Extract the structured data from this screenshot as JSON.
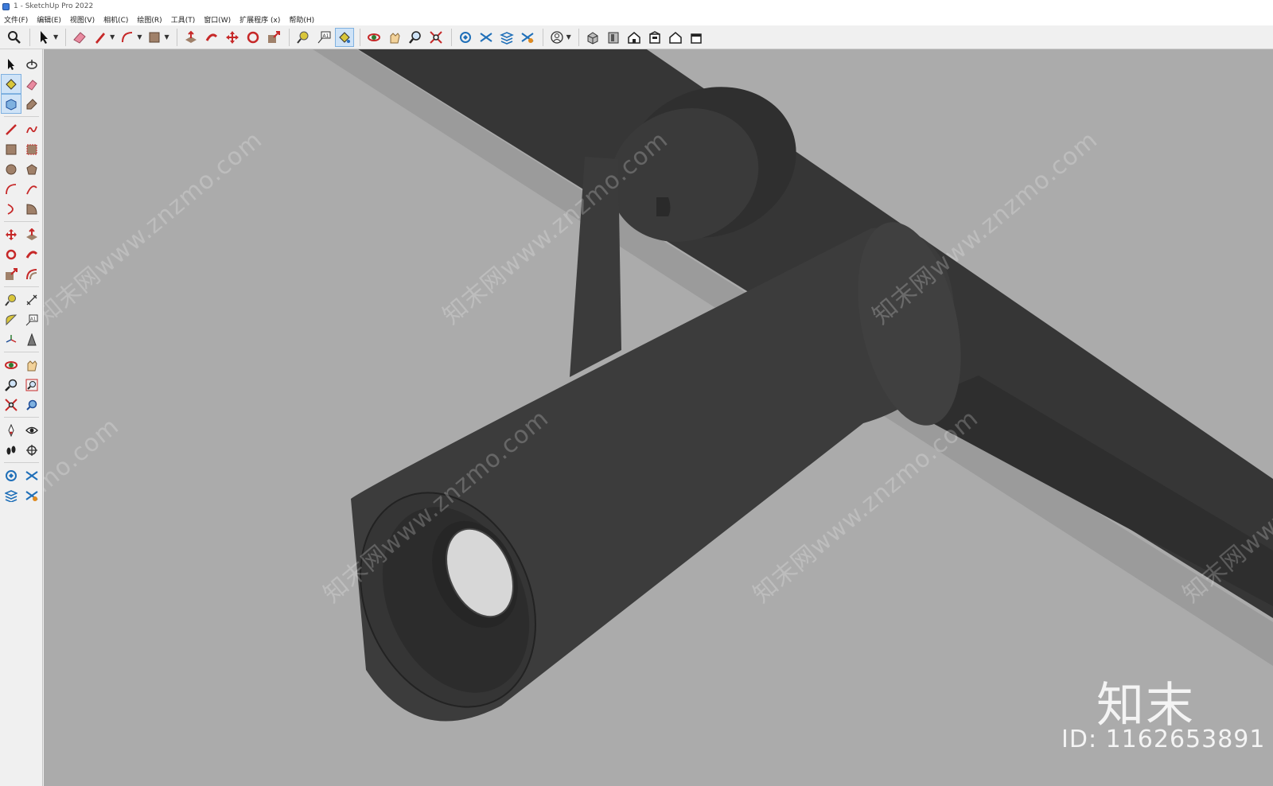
{
  "window": {
    "title": "1 - SketchUp Pro 2022",
    "accent": "#3d7bd9"
  },
  "menu": [
    "文件(F)",
    "编辑(E)",
    "视图(V)",
    "相机(C)",
    "绘图(R)",
    "工具(T)",
    "窗口(W)",
    "扩展程序 (x)",
    "帮助(H)"
  ],
  "toolbar": {
    "tools": [
      {
        "name": "zoom-icon"
      },
      {
        "name": "select-icon",
        "dropdown": true
      },
      {
        "name": "eraser-icon"
      },
      {
        "name": "pencil-icon",
        "dropdown": true
      },
      {
        "name": "arc-icon",
        "dropdown": true
      },
      {
        "name": "rectangle-icon",
        "dropdown": true
      },
      {
        "name": "push-pull-icon"
      },
      {
        "name": "follow-me-icon"
      },
      {
        "name": "move-icon"
      },
      {
        "name": "rotate-icon"
      },
      {
        "name": "scale-icon"
      },
      {
        "name": "tape-measure-icon"
      },
      {
        "name": "text-icon"
      },
      {
        "name": "paint-bucket-icon",
        "active": true
      },
      {
        "name": "orbit-icon"
      },
      {
        "name": "pan-icon"
      },
      {
        "name": "zoom-window-icon"
      },
      {
        "name": "zoom-extents-icon"
      },
      {
        "name": "warehouse-icon"
      },
      {
        "name": "extension-warehouse-icon"
      },
      {
        "name": "layout-icon"
      },
      {
        "name": "extension-manager-icon"
      },
      {
        "name": "account-icon",
        "dropdown": true
      },
      {
        "name": "iso-view-icon"
      },
      {
        "name": "top-view-icon"
      },
      {
        "name": "front-view-icon"
      },
      {
        "name": "right-view-icon"
      },
      {
        "name": "back-view-icon"
      },
      {
        "name": "left-view-icon"
      }
    ]
  },
  "watermark": {
    "text": "知末网www.znzmo.com"
  },
  "brand": {
    "logo": "知末",
    "id": "ID: 1162653891"
  },
  "colors": {
    "viewport_bg": "#ababab",
    "model": "#333333"
  }
}
